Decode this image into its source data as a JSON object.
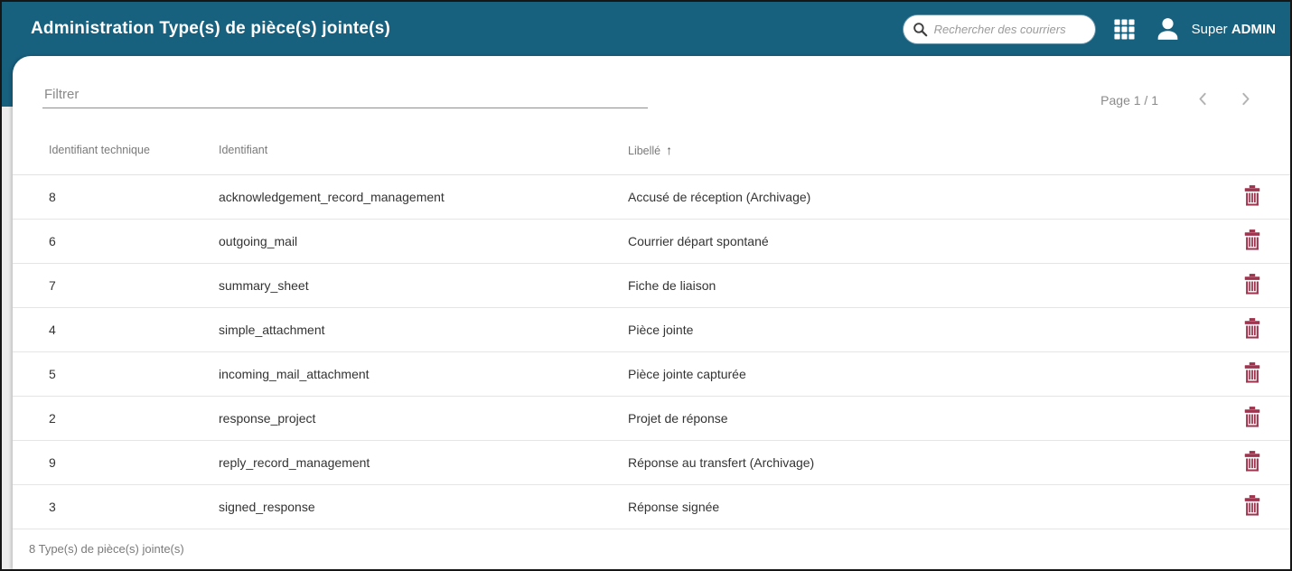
{
  "header": {
    "title": "Administration Type(s) de pièce(s) jointe(s)",
    "search_placeholder": "Rechercher des courriers",
    "user_first": "Super ",
    "user_last": "ADMIN"
  },
  "toolbar": {
    "filter_placeholder": "Filtrer",
    "page_label": "Page 1 / 1"
  },
  "table": {
    "columns": {
      "technical_id": "Identifiant technique",
      "identifier": "Identifiant",
      "label": "Libellé"
    },
    "sort": {
      "column": "Libellé",
      "direction": "asc"
    },
    "rows": [
      {
        "id": "8",
        "identifier": "acknowledgement_record_management",
        "label": "Accusé de réception (Archivage)"
      },
      {
        "id": "6",
        "identifier": "outgoing_mail",
        "label": "Courrier départ spontané"
      },
      {
        "id": "7",
        "identifier": "summary_sheet",
        "label": "Fiche de liaison"
      },
      {
        "id": "4",
        "identifier": "simple_attachment",
        "label": "Pièce jointe"
      },
      {
        "id": "5",
        "identifier": "incoming_mail_attachment",
        "label": "Pièce jointe capturée"
      },
      {
        "id": "2",
        "identifier": "response_project",
        "label": "Projet de réponse"
      },
      {
        "id": "9",
        "identifier": "reply_record_management",
        "label": "Réponse au transfert (Archivage)"
      },
      {
        "id": "3",
        "identifier": "signed_response",
        "label": "Réponse signée"
      }
    ],
    "footer": "8 Type(s) de pièce(s) jointe(s)"
  },
  "icons": {
    "search": "magnifier",
    "apps": "3x3-grid",
    "user": "person-silhouette",
    "sort_asc_glyph": "↑",
    "prev": "chevron-left",
    "next": "chevron-right",
    "delete": "trash-can"
  },
  "colors": {
    "header_bg": "#17607e",
    "delete_icon": "#9f344e",
    "row_divider": "#e5e5e5",
    "muted_text": "#7a7a7a"
  }
}
